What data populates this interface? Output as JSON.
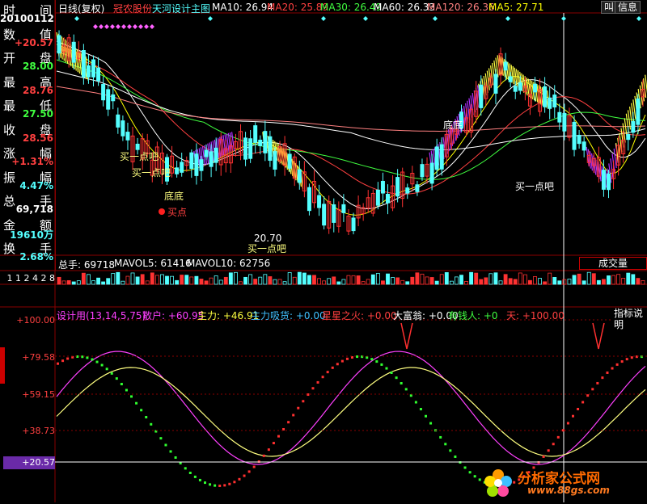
{
  "colors": {
    "up": "#ff3232",
    "down": "#54ffff",
    "ma10": "#ffffff",
    "ma20": "#ff4040",
    "ma30": "#40ff40",
    "ma60": "#ffffff",
    "ma120": "#ff8080",
    "ma5": "#ffff00",
    "bg": "#000000",
    "grid": "#8a0000"
  },
  "left_panel": {
    "rows": [
      {
        "a": "时",
        "b": "间",
        "value": "20100112",
        "color": "#ffffff"
      },
      {
        "a": "数",
        "b": "值",
        "value": "+20.57",
        "color": "#ff4040"
      },
      {
        "a": "开",
        "b": "盘",
        "value": "28.00",
        "color": "#40ff40"
      },
      {
        "a": "最",
        "b": "高",
        "value": "28.76",
        "color": "#ff4040"
      },
      {
        "a": "最",
        "b": "低",
        "value": "27.50",
        "color": "#40ff40"
      },
      {
        "a": "收",
        "b": "盘",
        "value": "28.56",
        "color": "#ff4040"
      },
      {
        "a": "涨",
        "b": "幅",
        "value": "+1.31%",
        "color": "#ff4040"
      },
      {
        "a": "振",
        "b": "幅",
        "value": "4.47%",
        "color": "#54ffff"
      },
      {
        "a": "总",
        "b": "手",
        "value": "69,718",
        "color": "#ffffff"
      },
      {
        "a": "金",
        "b": "额",
        "value": "19610万",
        "color": "#54ffff"
      },
      {
        "a": "换",
        "b": "手",
        "value": "2.68%",
        "color": "#54ffff"
      }
    ],
    "vol_axis": "1 1 2 4 2 8"
  },
  "header": {
    "period": "日线(复权)",
    "stock": "冠农股份",
    "indicator": "天河设计主图",
    "ma": [
      {
        "label": "MA10: 26.94",
        "color": "#ffffff"
      },
      {
        "label": "MA20: 25.89",
        "color": "#ff4040"
      },
      {
        "label": "MA30: 26.49",
        "color": "#40ff40"
      },
      {
        "label": "MA60: 26.33",
        "color": "#ffffff"
      },
      {
        "label": "MA120: 26.36",
        "color": "#ff8080"
      },
      {
        "label": "MA5: 27.71",
        "color": "#ffff00"
      }
    ],
    "btn_chart": "叫",
    "btn_info": "信息"
  },
  "annotations": {
    "buy_once": "买一点吧",
    "buy_point": "买点",
    "bottom": "底底",
    "low_price": "20.70"
  },
  "volume": {
    "label_total": "总手: 69718",
    "label_mavol5": "MAVOL5: 61416",
    "label_mavol10": "MAVOL10: 62756",
    "btn_volume": "成交量"
  },
  "indicator_panel": {
    "title": "设计用(13,14,5,75)",
    "items": [
      {
        "label": "散户: +60.95",
        "color": "#ff40ff"
      },
      {
        "label": "主力: +46.91",
        "color": "#ffff40"
      },
      {
        "label": "主力吸货: +0.00",
        "color": "#40c0ff"
      },
      {
        "label": "星星之火: +0.00",
        "color": "#ff4040"
      },
      {
        "label": "大富翁: +0.00",
        "color": "#ffffff"
      },
      {
        "label": "有钱人: +0",
        "color": "#40ff40"
      },
      {
        "label": "天: +100.00",
        "color": "#ff4040"
      }
    ],
    "help_btn": "指标说明",
    "axis": [
      "+100.00",
      "+79.58",
      "+59.15",
      "+38.73",
      "+20.57"
    ]
  },
  "watermark": {
    "name": "分析家公式网",
    "url": "www.88gs.com"
  },
  "chart_data": {
    "type": "candlestick",
    "price_range": [
      20.0,
      31.5
    ],
    "low_marker": 20.7,
    "indicator_range": [
      0,
      100
    ]
  }
}
